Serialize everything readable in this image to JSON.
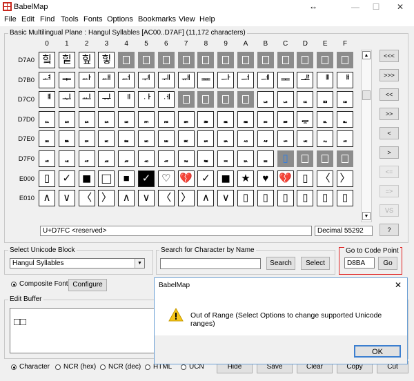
{
  "window": {
    "title": "BabelMap",
    "resize_glyph": "↔",
    "min_glyph": "—",
    "max_glyph": "☐",
    "close_glyph": "✕"
  },
  "menu": [
    "File",
    "Edit",
    "Find",
    "Tools",
    "Fonts",
    "Options",
    "Bookmarks",
    "View",
    "Help"
  ],
  "grid_panel": {
    "label": "Basic Multilingual Plane : Hangul Syllables [AC00..D7AF] (11,172 characters)",
    "col_headers": [
      "0",
      "1",
      "2",
      "3",
      "4",
      "5",
      "6",
      "7",
      "8",
      "9",
      "A",
      "B",
      "C",
      "D",
      "E",
      "F"
    ],
    "rows": [
      {
        "label": "D7A0",
        "cells": [
          {
            "c": "힠"
          },
          {
            "c": "힡"
          },
          {
            "c": "힢"
          },
          {
            "c": "힣"
          },
          {
            "c": "",
            "u": 1
          },
          {
            "c": "",
            "u": 1
          },
          {
            "c": "",
            "u": 1
          },
          {
            "c": "",
            "u": 1
          },
          {
            "c": "",
            "u": 1
          },
          {
            "c": "",
            "u": 1
          },
          {
            "c": "",
            "u": 1
          },
          {
            "c": "",
            "u": 1
          },
          {
            "c": "",
            "u": 1
          },
          {
            "c": "",
            "u": 1
          },
          {
            "c": "",
            "u": 1
          },
          {
            "c": "",
            "u": 1
          }
        ]
      },
      {
        "label": "D7B0",
        "cells": [
          {
            "c": "ힰ"
          },
          {
            "c": "ힱ"
          },
          {
            "c": "ힲ"
          },
          {
            "c": "ힳ"
          },
          {
            "c": "ힴ"
          },
          {
            "c": "ힵ"
          },
          {
            "c": "ힶ"
          },
          {
            "c": "ힷ"
          },
          {
            "c": "ힸ"
          },
          {
            "c": "ힹ"
          },
          {
            "c": "ힺ"
          },
          {
            "c": "ힻ"
          },
          {
            "c": "ힼ"
          },
          {
            "c": "ힽ"
          },
          {
            "c": "ힾ"
          },
          {
            "c": "ힿ"
          }
        ]
      },
      {
        "label": "D7C0",
        "cells": [
          {
            "c": "ퟀ"
          },
          {
            "c": "ퟁ"
          },
          {
            "c": "ퟂ"
          },
          {
            "c": "ퟃ"
          },
          {
            "c": "ퟄ"
          },
          {
            "c": "ퟅ"
          },
          {
            "c": "ퟆ"
          },
          {
            "c": "",
            "u": 1
          },
          {
            "c": "",
            "u": 1
          },
          {
            "c": "",
            "u": 1
          },
          {
            "c": "",
            "u": 1
          },
          {
            "c": "ퟋ",
            "s": 1
          },
          {
            "c": "ퟌ",
            "s": 1
          },
          {
            "c": "ퟍ",
            "s": 1
          },
          {
            "c": "ퟎ",
            "s": 1
          },
          {
            "c": "ퟏ",
            "s": 1
          }
        ]
      },
      {
        "label": "D7D0",
        "cells": [
          {
            "c": "ퟐ",
            "s": 1
          },
          {
            "c": "ퟑ",
            "s": 1
          },
          {
            "c": "ퟒ",
            "s": 1
          },
          {
            "c": "ퟓ",
            "s": 1
          },
          {
            "c": "ퟔ",
            "s": 1
          },
          {
            "c": "ퟕ",
            "s": 1
          },
          {
            "c": "ퟖ",
            "s": 1
          },
          {
            "c": "ퟗ",
            "s": 1
          },
          {
            "c": "ퟘ",
            "s": 1
          },
          {
            "c": "ퟙ",
            "s": 1
          },
          {
            "c": "ퟚ",
            "s": 1
          },
          {
            "c": "ퟛ",
            "s": 1
          },
          {
            "c": "ퟜ",
            "s": 1
          },
          {
            "c": "ퟝ"
          },
          {
            "c": "ퟞ",
            "s": 1
          },
          {
            "c": "ퟟ",
            "s": 1
          }
        ]
      },
      {
        "label": "D7E0",
        "cells": [
          {
            "c": "ퟠ",
            "s": 1
          },
          {
            "c": "ퟡ",
            "s": 1
          },
          {
            "c": "ퟢ",
            "s": 1
          },
          {
            "c": "ퟣ",
            "s": 1
          },
          {
            "c": "ퟤ",
            "s": 1
          },
          {
            "c": "ퟥ",
            "s": 1
          },
          {
            "c": "ퟦ",
            "s": 1
          },
          {
            "c": "ퟧ",
            "s": 1
          },
          {
            "c": "ퟨ",
            "s": 1
          },
          {
            "c": "ퟩ",
            "s": 1
          },
          {
            "c": "ퟪ",
            "s": 1
          },
          {
            "c": "ퟫ",
            "s": 1
          },
          {
            "c": "ퟬ",
            "s": 1
          },
          {
            "c": "ퟭ",
            "s": 1
          },
          {
            "c": "ퟮ",
            "s": 1
          },
          {
            "c": "ퟯ",
            "s": 1
          }
        ]
      },
      {
        "label": "D7F0",
        "cells": [
          {
            "c": "ퟰ",
            "s": 1
          },
          {
            "c": "ퟱ",
            "s": 1
          },
          {
            "c": "ퟲ",
            "s": 1
          },
          {
            "c": "ퟳ",
            "s": 1
          },
          {
            "c": "ퟴ",
            "s": 1
          },
          {
            "c": "ퟵ",
            "s": 1
          },
          {
            "c": "ퟶ",
            "s": 1
          },
          {
            "c": "ퟷ",
            "s": 1
          },
          {
            "c": "ퟸ",
            "s": 1
          },
          {
            "c": "ퟹ",
            "s": 1
          },
          {
            "c": "ퟺ",
            "s": 1
          },
          {
            "c": "ퟻ",
            "s": 1
          },
          {
            "c": "▯",
            "sel": 1
          },
          {
            "c": "",
            "u": 1
          },
          {
            "c": "",
            "u": 1
          },
          {
            "c": "",
            "u": 1
          }
        ]
      },
      {
        "label": "E000",
        "cells": [
          {
            "c": "▯"
          },
          {
            "c": "✓"
          },
          {
            "c": "■",
            "big": 1
          },
          {
            "c": "□",
            "big": 1
          },
          {
            "c": "■"
          },
          {
            "c": "✓",
            "d": 1
          },
          {
            "c": "♡"
          },
          {
            "c": "💔"
          },
          {
            "c": "✓"
          },
          {
            "c": "■",
            "big": 1
          },
          {
            "c": "★"
          },
          {
            "c": "♥"
          },
          {
            "c": "💔"
          },
          {
            "c": "▯"
          },
          {
            "c": "〈"
          },
          {
            "c": "〉"
          }
        ]
      },
      {
        "label": "E010",
        "cells": [
          {
            "c": "∧"
          },
          {
            "c": "∨"
          },
          {
            "c": "〈"
          },
          {
            "c": "〉"
          },
          {
            "c": "∧"
          },
          {
            "c": "∨"
          },
          {
            "c": "〈"
          },
          {
            "c": "〉"
          },
          {
            "c": "∧"
          },
          {
            "c": "∨"
          },
          {
            "c": "▯"
          },
          {
            "c": "▯"
          },
          {
            "c": "▯"
          },
          {
            "c": "▯"
          },
          {
            "c": "▯"
          },
          {
            "c": "▯"
          }
        ]
      }
    ],
    "status_left": "U+D7FC <reserved>",
    "status_right": "Decimal 55292"
  },
  "nav_buttons": [
    {
      "label": "<<<",
      "disabled": false
    },
    {
      "label": ">>>",
      "disabled": false
    },
    {
      "label": "<<",
      "disabled": false
    },
    {
      "label": ">>",
      "disabled": false
    },
    {
      "label": "<",
      "disabled": false
    },
    {
      "label": ">",
      "disabled": false
    },
    {
      "label": "<=",
      "disabled": true
    },
    {
      "label": "=>",
      "disabled": true
    },
    {
      "label": "VS",
      "disabled": true
    },
    {
      "label": "?",
      "disabled": false
    }
  ],
  "unicode_block": {
    "label": "Select Unicode Block",
    "value": "Hangul Syllables"
  },
  "search": {
    "label": "Search for Character by Name",
    "value": "",
    "search_btn": "Search",
    "select_btn": "Select"
  },
  "goto": {
    "label": "Go to Code Point",
    "value": "D8BA",
    "go_btn": "Go",
    "highlight_color": "#e02020"
  },
  "composite": {
    "label": "Composite Font",
    "configure_btn": "Configure"
  },
  "edit_buffer": {
    "label": "Edit Buffer",
    "content": "□□"
  },
  "bottom": {
    "radios": [
      "Character",
      "NCR (hex)",
      "NCR (dec)",
      "HTML",
      "UCN"
    ],
    "buttons": [
      "Hide",
      "Save",
      "Clear",
      "Copy",
      "Cut"
    ]
  },
  "dialog": {
    "title": "BabelMap",
    "close_glyph": "✕",
    "warning_glyph": "!",
    "message": "Out of Range (Select Options to change supported Unicode ranges)",
    "ok_btn": "OK"
  }
}
